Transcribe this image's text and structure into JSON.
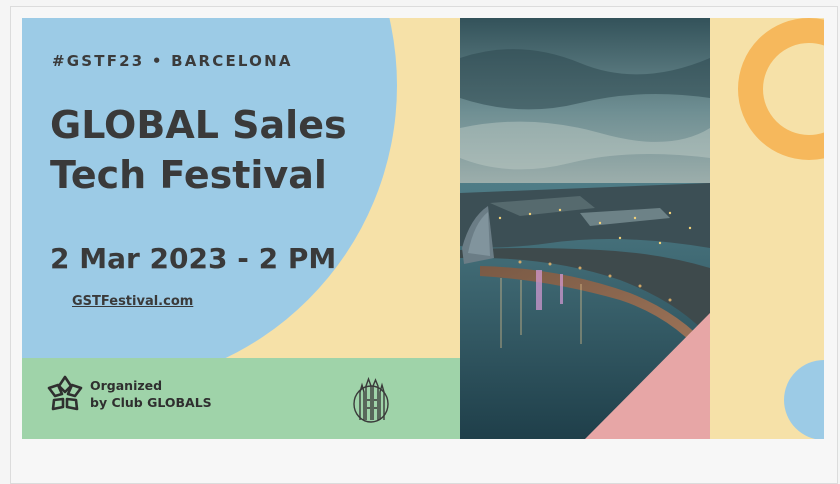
{
  "banner": {
    "tagline": "#GSTF23 • BARCELONA",
    "title_line1": "GLOBAL Sales",
    "title_line2": "Tech Festival",
    "date": "2 Mar 2023 - 2 PM",
    "website": "GSTFestival.com",
    "organizer_line1": "Organized",
    "organizer_line2": "by Club GLOBALS"
  },
  "icons": {
    "organizer_logo": "club-globals-logo-icon",
    "landmark": "sagrada-familia-icon",
    "photo": "barcelona-aerial-photo"
  },
  "colors": {
    "blue": "#9ccbe6",
    "cream": "#f6e1a8",
    "green": "#9fd3a9",
    "orange": "#f6b85c",
    "pink": "#e7a6a6",
    "text": "#3a3a3a"
  }
}
